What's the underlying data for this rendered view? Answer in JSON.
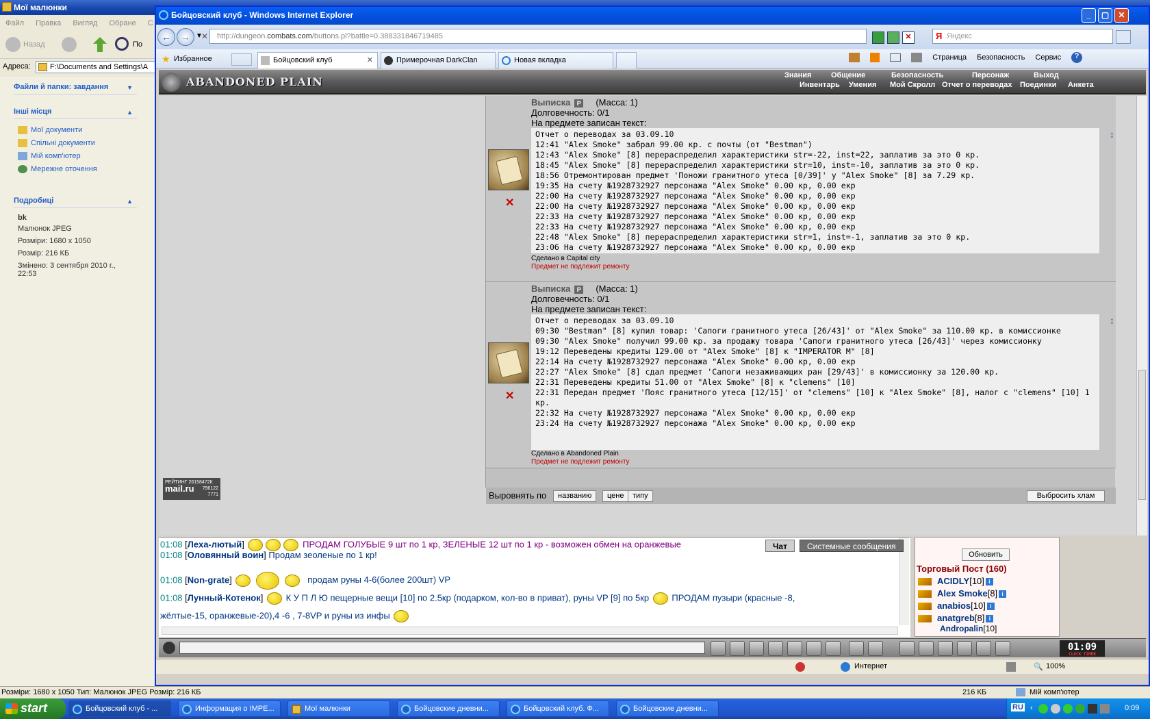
{
  "explorer": {
    "title": "Мої малюнки",
    "menu": [
      "Файл",
      "Правка",
      "Вигляд",
      "Обране",
      "С"
    ],
    "toolbar": {
      "back": "Назад",
      "search": "По"
    },
    "address_label": "Адреса:",
    "address_value": "F:\\Documents and Settings\\A",
    "tasks_header": "Файли й папки: завдання",
    "places_header": "Інші місця",
    "places": [
      "Мої документи",
      "Спільні документи",
      "Мій комп'ютер",
      "Мережне оточення"
    ],
    "details_header": "Подробиці",
    "details": {
      "name": "bk",
      "type": "Малюнок JPEG",
      "dimensions": "Розміри: 1680 x 1050",
      "size": "Розмір: 216 КБ",
      "modified": "Змінено: 3 сентября 2010 г., 22:53"
    },
    "status_left": "Розміри: 1680 x 1050 Тип: Малюнок JPEG Розмір: 216 КБ",
    "status_size": "216 КБ",
    "status_computer": "Мій комп'ютер"
  },
  "ie": {
    "title": "Бойцовский клуб - Windows Internet Explorer",
    "address_prefix": "http://dungeon.",
    "address_domain": "combats.com",
    "address_rest": "/buttons.pl?battle=0.388331846719485",
    "search_engine": "Я",
    "search_placeholder": "Яндекс",
    "favorites": "Избранное",
    "tabs": [
      "Бойцовский клуб",
      "Примерочная DarkClan",
      "Новая вкладка"
    ],
    "commands": [
      "Страница",
      "Безопасность",
      "Сервис"
    ],
    "status_zone": "Интернет",
    "zoom": "100%"
  },
  "game": {
    "logo": "ABANDONED PLAIN",
    "menu_top": [
      "Знания",
      "Общение",
      "Безопасность",
      "Персонаж",
      "Выход"
    ],
    "menu_bottom": [
      "Инвентарь",
      "Умения",
      "Мой Скролл",
      "Отчет о переводах",
      "Поединки",
      "Анкета"
    ],
    "items": [
      {
        "name": "Выписка",
        "mass": "(Масса: 1)",
        "durability": "Долговечность: 0/1",
        "text_label": "На предмете записан текст:",
        "lines": [
          "Отчет о переводах за 03.09.10",
          "12:41 \"Alex Smoke\" забрал 99.00 кр. с почты (от \"Bestman\")",
          "12:43 \"Alex Smoke\" [8] перераспределил характеристики str=-22, inst=22, заплатив за это 0 кр.",
          "18:45 \"Alex Smoke\" [8] перераспределил характеристики str=10, inst=-10, заплатив за это 0 кр.",
          "18:56 Отремонтирован предмет 'Поножи гранитного утеса [0/39]' у \"Alex Smoke\" [8] за 7.29 кр.",
          "19:35 На счету №1928732927 персонажа \"Alex Smoke\" 0.00 кр, 0.00 екр",
          "22:00 На счету №1928732927 персонажа \"Alex Smoke\" 0.00 кр, 0.00 екр",
          "22:00 На счету №1928732927 персонажа \"Alex Smoke\" 0.00 кр, 0.00 екр",
          "22:33 На счету №1928732927 персонажа \"Alex Smoke\" 0.00 кр, 0.00 екр",
          "22:33 На счету №1928732927 персонажа \"Alex Smoke\" 0.00 кр, 0.00 екр",
          "22:48 \"Alex Smoke\" [8] перераспределил характеристики str=1, inst=-1, заплатив за это 0 кр.",
          "23:06 На счету №1928732927 персонажа \"Alex Smoke\" 0.00 кр, 0.00 екр"
        ],
        "made_in": "Сделано в Capital city",
        "repair": "Предмет не подлежит ремонту"
      },
      {
        "name": "Выписка",
        "mass": "(Масса: 1)",
        "durability": "Долговечность: 0/1",
        "text_label": "На предмете записан текст:",
        "lines": [
          "Отчет о переводах за 03.09.10",
          "09:30 \"Bestman\" [8] купил товар: 'Сапоги гранитного утеса [26/43]' от \"Alex Smoke\" за 110.00 кр. в комиссионке",
          "09:30 \"Alex Smoke\" получил 99.00 кр. за продажу товара 'Сапоги гранитного утеса [26/43]' через комиссионку",
          "19:12 Переведены кредиты 129.00 от \"Alex Smoke\" [8] к \"IMPERATOR M\" [8]",
          "22:14 На счету №1928732927 персонажа \"Alex Smoke\" 0.00 кр, 0.00 екр",
          "22:27 \"Alex Smoke\" [8] сдал предмет 'Сапоги незаживающих ран [29/43]' в комиссионку за 120.00 кр.",
          "22:31 Переведены кредиты 51.00 от \"Alex Smoke\" [8] к \"clemens\" [10]",
          "22:31 Передан предмет 'Пояс гранитного утеса [12/15]' от \"clemens\" [10] к \"Alex Smoke\" [8], налог с \"clemens\" [10] 1 кр.",
          "22:32 На счету №1928732927 персонажа \"Alex Smoke\" 0.00 кр, 0.00 екр",
          "23:24 На счету №1928732927 персонажа \"Alex Smoke\" 0.00 кр, 0.00 екр"
        ],
        "made_in": "Сделано в Abandoned Plain",
        "repair": "Предмет не подлежит ремонту"
      }
    ],
    "sort_label": "Выровнять по",
    "sort_buttons": [
      "названию",
      "цене",
      "типу"
    ],
    "drop_button": "Выбросить хлам",
    "rating": {
      "label": "РЕЙТИНГ 26158472К",
      "site": "mail.ru",
      "n1": "796122",
      "n2": "7771"
    },
    "chat_tabs": [
      "Чат",
      "Системные сообщения"
    ],
    "chat": [
      {
        "time": "01:08",
        "nick": "Леха-лютый",
        "msg": "ПРОДАМ ГОЛУБЫЕ 9 шт по 1 кр, ЗЕЛЕНЫЕ 12 шт по 1 кр - возможен обмен на оранжевые"
      },
      {
        "time": "01:08",
        "nick": "Оловянный воин",
        "msg": "Продам зеоленые по 1 кр!"
      },
      {
        "time": "01:08",
        "nick": "Non-grate",
        "msg": "продам руны 4-6(более 200шт) VP"
      },
      {
        "time": "01:08",
        "nick": "Лунный-Котенок",
        "msg": "К У П Л Ю пещерные вещи [10] по 2.5кр (подарком, кол-во в приват), руны VP [9] по 5кр",
        "msg2": "ПРОДАМ пузыри (красные -8,",
        "msg3": "жёлтые-15, оранжевые-20),4 -6 , 7-8VP и руны из инфы"
      }
    ],
    "refresh": "Обновить",
    "trade_title": "Торговый Пост (160)",
    "trade_users": [
      {
        "nick": "ACIDLY",
        "lv": "[10]"
      },
      {
        "nick": "Alex Smoke",
        "lv": "[8]"
      },
      {
        "nick": "anabios",
        "lv": "[10]"
      },
      {
        "nick": "anatgreb",
        "lv": "[8]"
      },
      {
        "nick": "Andropalin",
        "lv": "[10]"
      }
    ],
    "clock": "01:09",
    "clock_label": "CLOCK TIMER"
  },
  "taskbar": {
    "start": "start",
    "buttons": [
      "Бойцовский клуб - ...",
      "Информация о IMPE...",
      "Мої малюнки",
      "Бойцовские дневни...",
      "Бойцовский клуб. Ф...",
      "Бойцовские дневни..."
    ],
    "lang": "RU",
    "time": "0:09"
  }
}
